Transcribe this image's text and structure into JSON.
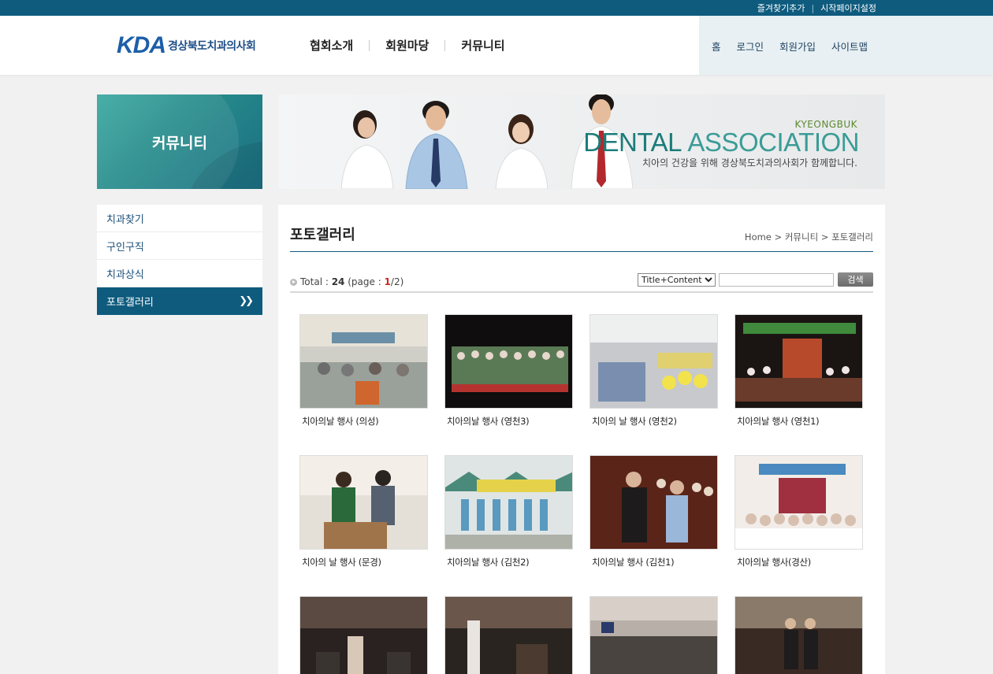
{
  "topbar": {
    "bookmark": "즐겨찾기추가",
    "sep": "|",
    "homepage": "시작페이지설정"
  },
  "logo": {
    "mark": "KDA",
    "org": "경상북도치과의사회"
  },
  "gnb": [
    "협회소개",
    "회원마당",
    "커뮤니티"
  ],
  "util": [
    "홈",
    "로그인",
    "회원가입",
    "사이트맵"
  ],
  "side": {
    "title": "커뮤니티"
  },
  "banner": {
    "kyeongbuk": "KYEONGBUK",
    "dental": "DENTAL",
    "association": "ASSOCIATION",
    "slogan": "치아의 건강을 위해 경상북도치과의사회가 함께합니다."
  },
  "lnb": [
    {
      "label": "치과찾기"
    },
    {
      "label": "구인구직"
    },
    {
      "label": "치과상식"
    },
    {
      "label": "포토갤러리",
      "active": true,
      "icon": "double-chevron-right-icon"
    }
  ],
  "content": {
    "title": "포토갤러리",
    "breadcrumb": "Home > 커뮤니티 > 포토갤러리",
    "total_label": "Total : ",
    "total": "24",
    "page_label": " (page : ",
    "page_current": "1",
    "page_total": "/2)"
  },
  "search": {
    "field": "Title+Content",
    "query": "",
    "button": "검색"
  },
  "gallery": [
    {
      "caption": "치아의날 행사 (의성)"
    },
    {
      "caption": "치아의날 행사 (영천3)"
    },
    {
      "caption": "치아의 날 행사 (영천2)"
    },
    {
      "caption": "치아의날 행사 (영천1)"
    },
    {
      "caption": "치아의 날 행사 (문경)"
    },
    {
      "caption": "치아의날 행사 (김천2)"
    },
    {
      "caption": "치아의날 행사 (김천1)"
    },
    {
      "caption": "치아의날 행사(경산)"
    },
    {
      "caption": ""
    },
    {
      "caption": ""
    },
    {
      "caption": ""
    },
    {
      "caption": ""
    }
  ],
  "colors": {
    "primary": "#0e5b7e",
    "accent_red": "#d0291f",
    "teal": "#258a8a"
  }
}
